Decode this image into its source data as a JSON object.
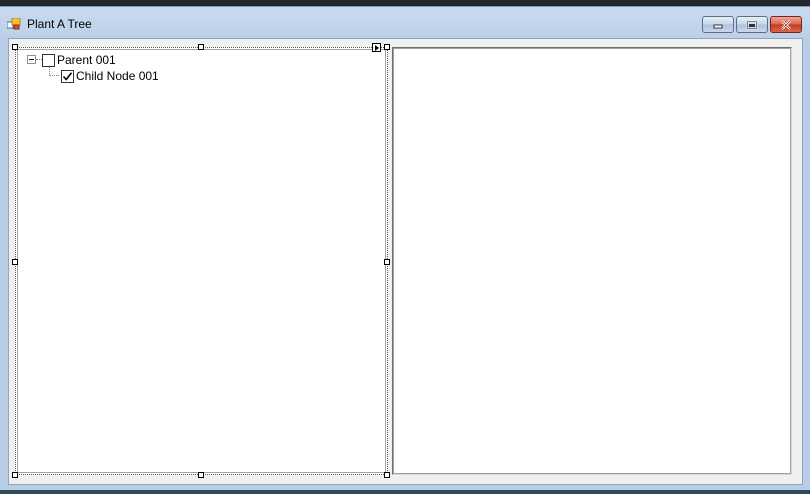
{
  "window": {
    "title": "Plant A Tree",
    "controls": {
      "minimize": "minimize",
      "maximize": "maximize",
      "close": "close"
    }
  },
  "tree": {
    "nodes": [
      {
        "label": "Parent 001",
        "checked": false,
        "expanded": true
      },
      {
        "label": "Child Node 001",
        "checked": true
      }
    ]
  },
  "colors": {
    "close_button": "#c4391f",
    "titlebar": "#c9dbee"
  }
}
